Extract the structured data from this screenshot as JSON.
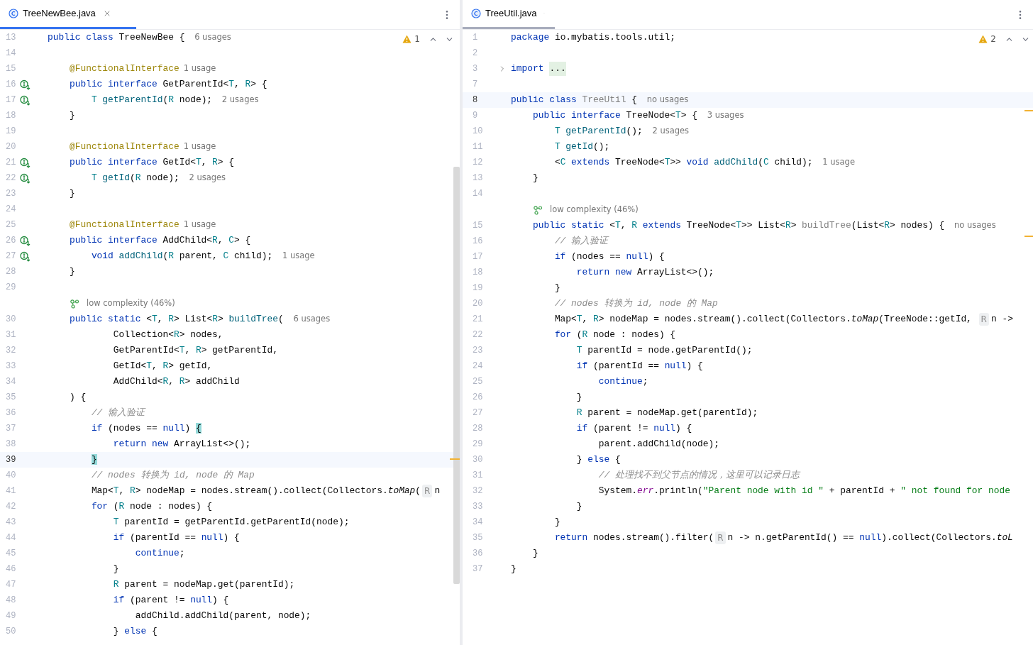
{
  "editors": [
    {
      "focused": true,
      "tab": {
        "title": "TreeNewBee.java",
        "selected": true
      },
      "warnings": "1",
      "lines": [
        {
          "kind": "code",
          "number": "13",
          "current": false,
          "tokens": [
            {
              "kind": "kw",
              "text": "public class"
            },
            {
              "kind": "pl",
              "text": " TreeNewBee { "
            },
            {
              "kind": "hint",
              "text": "6 usages"
            }
          ]
        },
        {
          "kind": "code",
          "number": "14",
          "current": false
        },
        {
          "kind": "code",
          "number": "15",
          "current": false,
          "tokens": [
            {
              "kind": "an",
              "text": "    @FunctionalInterface"
            },
            {
              "kind": "hint",
              "text": "1 usage"
            }
          ]
        },
        {
          "kind": "implementing",
          "number": "16",
          "current": false,
          "tokens": [
            {
              "kind": "kw",
              "text": "    public interface"
            },
            {
              "kind": "pl",
              "text": " GetParentId<"
            },
            {
              "kind": "tp",
              "text": "T"
            },
            {
              "kind": "pl",
              "text": ", "
            },
            {
              "kind": "tp",
              "text": "R"
            },
            {
              "kind": "pl",
              "text": "> {"
            }
          ]
        },
        {
          "kind": "implementing",
          "number": "17",
          "current": false,
          "tokens": [
            {
              "kind": "tp",
              "text": "        T"
            },
            {
              "kind": "fn",
              "text": " getParentId"
            },
            {
              "kind": "pl",
              "text": "("
            },
            {
              "kind": "tp",
              "text": "R"
            },
            {
              "kind": "pl",
              "text": " node); "
            },
            {
              "kind": "hint",
              "text": "2 usages"
            }
          ]
        },
        {
          "kind": "code",
          "number": "18",
          "current": false,
          "tokens": [
            {
              "kind": "pl",
              "text": "    }"
            }
          ]
        },
        {
          "kind": "code",
          "number": "19",
          "current": false
        },
        {
          "kind": "code",
          "number": "20",
          "current": false,
          "tokens": [
            {
              "kind": "an",
              "text": "    @FunctionalInterface"
            },
            {
              "kind": "hint",
              "text": "1 usage"
            }
          ]
        },
        {
          "kind": "implementing",
          "number": "21",
          "current": false,
          "tokens": [
            {
              "kind": "kw",
              "text": "    public interface"
            },
            {
              "kind": "pl",
              "text": " GetId<"
            },
            {
              "kind": "tp",
              "text": "T"
            },
            {
              "kind": "pl",
              "text": ", "
            },
            {
              "kind": "tp",
              "text": "R"
            },
            {
              "kind": "pl",
              "text": "> {"
            }
          ]
        },
        {
          "kind": "implementing",
          "number": "22",
          "current": false,
          "tokens": [
            {
              "kind": "tp",
              "text": "        T"
            },
            {
              "kind": "fn",
              "text": " getId"
            },
            {
              "kind": "pl",
              "text": "("
            },
            {
              "kind": "tp",
              "text": "R"
            },
            {
              "kind": "pl",
              "text": " node); "
            },
            {
              "kind": "hint",
              "text": "2 usages"
            }
          ]
        },
        {
          "kind": "code",
          "number": "23",
          "current": false,
          "tokens": [
            {
              "kind": "pl",
              "text": "    }"
            }
          ]
        },
        {
          "kind": "code",
          "number": "24",
          "current": false
        },
        {
          "kind": "code",
          "number": "25",
          "current": false,
          "tokens": [
            {
              "kind": "an",
              "text": "    @FunctionalInterface"
            },
            {
              "kind": "hint",
              "text": "1 usage"
            }
          ]
        },
        {
          "kind": "implementing",
          "number": "26",
          "current": false,
          "tokens": [
            {
              "kind": "kw",
              "text": "    public interface"
            },
            {
              "kind": "pl",
              "text": " AddChild<"
            },
            {
              "kind": "tp",
              "text": "R"
            },
            {
              "kind": "pl",
              "text": ", "
            },
            {
              "kind": "tp",
              "text": "C"
            },
            {
              "kind": "pl",
              "text": "> {"
            }
          ]
        },
        {
          "kind": "implementing",
          "number": "27",
          "current": false,
          "tokens": [
            {
              "kind": "kw",
              "text": "        void"
            },
            {
              "kind": "fn",
              "text": " addChild"
            },
            {
              "kind": "pl",
              "text": "("
            },
            {
              "kind": "tp",
              "text": "R"
            },
            {
              "kind": "pl",
              "text": " parent, "
            },
            {
              "kind": "tp",
              "text": "C"
            },
            {
              "kind": "pl",
              "text": " child); "
            },
            {
              "kind": "hint",
              "text": "1 usage"
            }
          ]
        },
        {
          "kind": "code",
          "number": "28",
          "current": false,
          "tokens": [
            {
              "kind": "pl",
              "text": "    }"
            }
          ]
        },
        {
          "kind": "code",
          "number": "29",
          "current": false
        },
        {
          "kind": "complexity",
          "text": "low complexity (46%)"
        },
        {
          "kind": "code",
          "number": "30",
          "current": false,
          "tokens": [
            {
              "kind": "kw",
              "text": "    public static"
            },
            {
              "kind": "pl",
              "text": " <"
            },
            {
              "kind": "tp",
              "text": "T"
            },
            {
              "kind": "pl",
              "text": ", "
            },
            {
              "kind": "tp",
              "text": "R"
            },
            {
              "kind": "pl",
              "text": "> List<"
            },
            {
              "kind": "tp",
              "text": "R"
            },
            {
              "kind": "pl",
              "text": ">"
            },
            {
              "kind": "fn",
              "text": " buildTree"
            },
            {
              "kind": "pl",
              "text": "( "
            },
            {
              "kind": "hint",
              "text": "6 usages"
            }
          ]
        },
        {
          "kind": "code",
          "number": "31",
          "current": false,
          "tokens": [
            {
              "kind": "pl",
              "text": "            Collection<"
            },
            {
              "kind": "tp",
              "text": "R"
            },
            {
              "kind": "pl",
              "text": "> nodes,"
            }
          ]
        },
        {
          "kind": "code",
          "number": "32",
          "current": false,
          "tokens": [
            {
              "kind": "pl",
              "text": "            GetParentId<"
            },
            {
              "kind": "tp",
              "text": "T"
            },
            {
              "kind": "pl",
              "text": ", "
            },
            {
              "kind": "tp",
              "text": "R"
            },
            {
              "kind": "pl",
              "text": "> getParentId,"
            }
          ]
        },
        {
          "kind": "code",
          "number": "33",
          "current": false,
          "tokens": [
            {
              "kind": "pl",
              "text": "            GetId<"
            },
            {
              "kind": "tp",
              "text": "T"
            },
            {
              "kind": "pl",
              "text": ", "
            },
            {
              "kind": "tp",
              "text": "R"
            },
            {
              "kind": "pl",
              "text": "> getId,"
            }
          ]
        },
        {
          "kind": "code",
          "number": "34",
          "current": false,
          "tokens": [
            {
              "kind": "pl",
              "text": "            AddChild<"
            },
            {
              "kind": "tp",
              "text": "R"
            },
            {
              "kind": "pl",
              "text": ", "
            },
            {
              "kind": "tp",
              "text": "R"
            },
            {
              "kind": "pl",
              "text": "> addChild"
            }
          ]
        },
        {
          "kind": "code",
          "number": "35",
          "current": false,
          "tokens": [
            {
              "kind": "pl",
              "text": "    ) {"
            }
          ]
        },
        {
          "kind": "code",
          "number": "36",
          "current": false,
          "tokens": [
            {
              "kind": "cm",
              "text": "        // 输入验证"
            }
          ]
        },
        {
          "kind": "code",
          "number": "37",
          "current": false,
          "tokens": [
            {
              "kind": "kw",
              "text": "        if"
            },
            {
              "kind": "pl",
              "text": " (nodes == "
            },
            {
              "kind": "kw",
              "text": "null"
            },
            {
              "kind": "pl",
              "text": ") "
            },
            {
              "kind": "brace",
              "text": "{"
            }
          ]
        },
        {
          "kind": "code",
          "number": "38",
          "current": false,
          "tokens": [
            {
              "kind": "kw",
              "text": "            return new"
            },
            {
              "kind": "pl",
              "text": " ArrayList<>();"
            }
          ]
        },
        {
          "kind": "code",
          "number": "39",
          "current": true,
          "tokens": [
            {
              "kind": "brace",
              "text": "        }"
            }
          ]
        },
        {
          "kind": "code",
          "number": "40",
          "current": false,
          "tokens": [
            {
              "kind": "cm",
              "text": "        // nodes 转换为 id, node 的 Map"
            }
          ]
        },
        {
          "kind": "code",
          "number": "41",
          "current": false,
          "tokens": [
            {
              "kind": "pl",
              "text": "        Map<"
            },
            {
              "kind": "tp",
              "text": "T"
            },
            {
              "kind": "pl",
              "text": ", "
            },
            {
              "kind": "tp",
              "text": "R"
            },
            {
              "kind": "pl",
              "text": "> nodeMap = nodes.stream().collect(Collectors."
            },
            {
              "kind": "it",
              "text": "toMap"
            },
            {
              "kind": "pl",
              "text": "("
            },
            {
              "kind": "param",
              "text": "R"
            },
            {
              "kind": "pl",
              "text": "n"
            }
          ]
        },
        {
          "kind": "code",
          "number": "42",
          "current": false,
          "tokens": [
            {
              "kind": "kw",
              "text": "        for"
            },
            {
              "kind": "pl",
              "text": " ("
            },
            {
              "kind": "tp",
              "text": "R"
            },
            {
              "kind": "pl",
              "text": " node : nodes) {"
            }
          ]
        },
        {
          "kind": "code",
          "number": "43",
          "current": false,
          "tokens": [
            {
              "kind": "tp",
              "text": "            T"
            },
            {
              "kind": "pl",
              "text": " parentId = getParentId.getParentId(node);"
            }
          ]
        },
        {
          "kind": "code",
          "number": "44",
          "current": false,
          "tokens": [
            {
              "kind": "kw",
              "text": "            if"
            },
            {
              "kind": "pl",
              "text": " (parentId == "
            },
            {
              "kind": "kw",
              "text": "null"
            },
            {
              "kind": "pl",
              "text": ") {"
            }
          ]
        },
        {
          "kind": "code",
          "number": "45",
          "current": false,
          "tokens": [
            {
              "kind": "kw",
              "text": "                continue"
            },
            {
              "kind": "pl",
              "text": ";"
            }
          ]
        },
        {
          "kind": "code",
          "number": "46",
          "current": false,
          "tokens": [
            {
              "kind": "pl",
              "text": "            }"
            }
          ]
        },
        {
          "kind": "code",
          "number": "47",
          "current": false,
          "tokens": [
            {
              "kind": "tp",
              "text": "            R"
            },
            {
              "kind": "pl",
              "text": " parent = nodeMap.get(parentId);"
            }
          ]
        },
        {
          "kind": "code",
          "number": "48",
          "current": false,
          "tokens": [
            {
              "kind": "kw",
              "text": "            if"
            },
            {
              "kind": "pl",
              "text": " (parent != "
            },
            {
              "kind": "kw",
              "text": "null"
            },
            {
              "kind": "pl",
              "text": ") {"
            }
          ]
        },
        {
          "kind": "code",
          "number": "49",
          "current": false,
          "tokens": [
            {
              "kind": "pl",
              "text": "                addChild.addChild(parent, node);"
            }
          ]
        },
        {
          "kind": "code",
          "number": "50",
          "current": false,
          "tokens": [
            {
              "kind": "pl",
              "text": "            } "
            },
            {
              "kind": "kw",
              "text": "else"
            },
            {
              "kind": "pl",
              "text": " {"
            }
          ]
        }
      ]
    },
    {
      "focused": false,
      "tab": {
        "title": "TreeUtil.java",
        "selected": true
      },
      "warnings": "2",
      "lines": [
        {
          "kind": "code",
          "number": "1",
          "current": false,
          "tokens": [
            {
              "kind": "kw",
              "text": "package"
            },
            {
              "kind": "pl",
              "text": " io.mybatis.tools.util;"
            }
          ]
        },
        {
          "kind": "code",
          "number": "2",
          "current": false
        },
        {
          "kind": "folded",
          "number": "3",
          "current": false,
          "tokens": [
            {
              "kind": "kw",
              "text": "import"
            },
            {
              "kind": "fold",
              "text": "..."
            }
          ]
        },
        {
          "kind": "code",
          "number": "7",
          "current": false
        },
        {
          "kind": "code",
          "number": "8",
          "current": true,
          "tokens": [
            {
              "kind": "kw",
              "text": "public class"
            },
            {
              "kind": "un",
              "text": " TreeUtil"
            },
            {
              "kind": "pl",
              "text": " { "
            },
            {
              "kind": "hint",
              "text": "no usages"
            }
          ]
        },
        {
          "kind": "code",
          "number": "9",
          "current": false,
          "tokens": [
            {
              "kind": "kw",
              "text": "    public interface"
            },
            {
              "kind": "pl",
              "text": " TreeNode<"
            },
            {
              "kind": "tp",
              "text": "T"
            },
            {
              "kind": "pl",
              "text": "> { "
            },
            {
              "kind": "hint",
              "text": "3 usages"
            }
          ]
        },
        {
          "kind": "code",
          "number": "10",
          "current": false,
          "tokens": [
            {
              "kind": "tp",
              "text": "        T"
            },
            {
              "kind": "fn",
              "text": " getParentId"
            },
            {
              "kind": "pl",
              "text": "(); "
            },
            {
              "kind": "hint",
              "text": "2 usages"
            }
          ]
        },
        {
          "kind": "code",
          "number": "11",
          "current": false,
          "tokens": [
            {
              "kind": "tp",
              "text": "        T"
            },
            {
              "kind": "fn",
              "text": " getId"
            },
            {
              "kind": "pl",
              "text": "();"
            }
          ]
        },
        {
          "kind": "code",
          "number": "12",
          "current": false,
          "tokens": [
            {
              "kind": "pl",
              "text": "        <"
            },
            {
              "kind": "tp",
              "text": "C"
            },
            {
              "kind": "kw",
              "text": " extends"
            },
            {
              "kind": "pl",
              "text": " TreeNode<"
            },
            {
              "kind": "tp",
              "text": "T"
            },
            {
              "kind": "pl",
              "text": ">>"
            },
            {
              "kind": "kw",
              "text": " void"
            },
            {
              "kind": "fn",
              "text": " addChild"
            },
            {
              "kind": "pl",
              "text": "("
            },
            {
              "kind": "tp",
              "text": "C"
            },
            {
              "kind": "pl",
              "text": " child); "
            },
            {
              "kind": "hint",
              "text": "1 usage"
            }
          ]
        },
        {
          "kind": "code",
          "number": "13",
          "current": false,
          "tokens": [
            {
              "kind": "pl",
              "text": "    }"
            }
          ]
        },
        {
          "kind": "code",
          "number": "14",
          "current": false
        },
        {
          "kind": "complexity",
          "text": "low complexity (46%)"
        },
        {
          "kind": "code",
          "number": "15",
          "current": false,
          "tokens": [
            {
              "kind": "kw",
              "text": "    public static"
            },
            {
              "kind": "pl",
              "text": " <"
            },
            {
              "kind": "tp",
              "text": "T"
            },
            {
              "kind": "pl",
              "text": ", "
            },
            {
              "kind": "tp",
              "text": "R"
            },
            {
              "kind": "kw",
              "text": " extends"
            },
            {
              "kind": "pl",
              "text": " TreeNode<"
            },
            {
              "kind": "tp",
              "text": "T"
            },
            {
              "kind": "pl",
              "text": ">> List<"
            },
            {
              "kind": "tp",
              "text": "R"
            },
            {
              "kind": "pl",
              "text": ">"
            },
            {
              "kind": "un",
              "text": " buildTree"
            },
            {
              "kind": "pl",
              "text": "(List<"
            },
            {
              "kind": "tp",
              "text": "R"
            },
            {
              "kind": "pl",
              "text": "> nodes) { "
            },
            {
              "kind": "hint",
              "text": "no usages"
            }
          ]
        },
        {
          "kind": "code",
          "number": "16",
          "current": false,
          "tokens": [
            {
              "kind": "cm",
              "text": "        // 输入验证"
            }
          ]
        },
        {
          "kind": "code",
          "number": "17",
          "current": false,
          "tokens": [
            {
              "kind": "kw",
              "text": "        if"
            },
            {
              "kind": "pl",
              "text": " (nodes == "
            },
            {
              "kind": "kw",
              "text": "null"
            },
            {
              "kind": "pl",
              "text": ") {"
            }
          ]
        },
        {
          "kind": "code",
          "number": "18",
          "current": false,
          "tokens": [
            {
              "kind": "kw",
              "text": "            return new"
            },
            {
              "kind": "pl",
              "text": " ArrayList<>();"
            }
          ]
        },
        {
          "kind": "code",
          "number": "19",
          "current": false,
          "tokens": [
            {
              "kind": "pl",
              "text": "        }"
            }
          ]
        },
        {
          "kind": "code",
          "number": "20",
          "current": false,
          "tokens": [
            {
              "kind": "cm",
              "text": "        // nodes 转换为 id, node 的 Map"
            }
          ]
        },
        {
          "kind": "code",
          "number": "21",
          "current": false,
          "tokens": [
            {
              "kind": "pl",
              "text": "        Map<"
            },
            {
              "kind": "tp",
              "text": "T"
            },
            {
              "kind": "pl",
              "text": ", "
            },
            {
              "kind": "tp",
              "text": "R"
            },
            {
              "kind": "pl",
              "text": "> nodeMap = nodes.stream().collect(Collectors."
            },
            {
              "kind": "it",
              "text": "toMap"
            },
            {
              "kind": "pl",
              "text": "(TreeNode::getId, "
            },
            {
              "kind": "param",
              "text": "R"
            },
            {
              "kind": "pl",
              "text": "n ->"
            }
          ]
        },
        {
          "kind": "code",
          "number": "22",
          "current": false,
          "tokens": [
            {
              "kind": "kw",
              "text": "        for"
            },
            {
              "kind": "pl",
              "text": " ("
            },
            {
              "kind": "tp",
              "text": "R"
            },
            {
              "kind": "pl",
              "text": " node : nodes) {"
            }
          ]
        },
        {
          "kind": "code",
          "number": "23",
          "current": false,
          "tokens": [
            {
              "kind": "tp",
              "text": "            T"
            },
            {
              "kind": "pl",
              "text": " parentId = node.getParentId();"
            }
          ]
        },
        {
          "kind": "code",
          "number": "24",
          "current": false,
          "tokens": [
            {
              "kind": "kw",
              "text": "            if"
            },
            {
              "kind": "pl",
              "text": " (parentId == "
            },
            {
              "kind": "kw",
              "text": "null"
            },
            {
              "kind": "pl",
              "text": ") {"
            }
          ]
        },
        {
          "kind": "code",
          "number": "25",
          "current": false,
          "tokens": [
            {
              "kind": "kw",
              "text": "                continue"
            },
            {
              "kind": "pl",
              "text": ";"
            }
          ]
        },
        {
          "kind": "code",
          "number": "26",
          "current": false,
          "tokens": [
            {
              "kind": "pl",
              "text": "            }"
            }
          ]
        },
        {
          "kind": "code",
          "number": "27",
          "current": false,
          "tokens": [
            {
              "kind": "tp",
              "text": "            R"
            },
            {
              "kind": "pl",
              "text": " parent = nodeMap.get(parentId);"
            }
          ]
        },
        {
          "kind": "code",
          "number": "28",
          "current": false,
          "tokens": [
            {
              "kind": "kw",
              "text": "            if"
            },
            {
              "kind": "pl",
              "text": " (parent != "
            },
            {
              "kind": "kw",
              "text": "null"
            },
            {
              "kind": "pl",
              "text": ") {"
            }
          ]
        },
        {
          "kind": "code",
          "number": "29",
          "current": false,
          "tokens": [
            {
              "kind": "pl",
              "text": "                parent.addChild(node);"
            }
          ]
        },
        {
          "kind": "code",
          "number": "30",
          "current": false,
          "tokens": [
            {
              "kind": "pl",
              "text": "            } "
            },
            {
              "kind": "kw",
              "text": "else"
            },
            {
              "kind": "pl",
              "text": " {"
            }
          ]
        },
        {
          "kind": "code",
          "number": "31",
          "current": false,
          "tokens": [
            {
              "kind": "cm",
              "text": "                // 处理找不到父节点的情况，这里可以记录日志"
            }
          ]
        },
        {
          "kind": "code",
          "number": "32",
          "current": false,
          "tokens": [
            {
              "kind": "pl",
              "text": "                System."
            },
            {
              "kind": "fd",
              "text": "err"
            },
            {
              "kind": "pl",
              "text": ".println("
            },
            {
              "kind": "st",
              "text": "\"Parent node with id \""
            },
            {
              "kind": "pl",
              "text": " + parentId + "
            },
            {
              "kind": "st",
              "text": "\" not found for node"
            }
          ]
        },
        {
          "kind": "code",
          "number": "33",
          "current": false,
          "tokens": [
            {
              "kind": "pl",
              "text": "            }"
            }
          ]
        },
        {
          "kind": "code",
          "number": "34",
          "current": false,
          "tokens": [
            {
              "kind": "pl",
              "text": "        }"
            }
          ]
        },
        {
          "kind": "code",
          "number": "35",
          "current": false,
          "tokens": [
            {
              "kind": "kw",
              "text": "        return"
            },
            {
              "kind": "pl",
              "text": " nodes.stream().filter("
            },
            {
              "kind": "param",
              "text": "R"
            },
            {
              "kind": "pl",
              "text": "n -> n.getParentId() == "
            },
            {
              "kind": "kw",
              "text": "null"
            },
            {
              "kind": "pl",
              "text": ").collect(Collectors."
            },
            {
              "kind": "it",
              "text": "toL"
            }
          ]
        },
        {
          "kind": "code",
          "number": "36",
          "current": false,
          "tokens": [
            {
              "kind": "pl",
              "text": "    }"
            }
          ]
        },
        {
          "kind": "code",
          "number": "37",
          "current": false,
          "tokens": [
            {
              "kind": "pl",
              "text": "}"
            }
          ]
        }
      ]
    }
  ]
}
